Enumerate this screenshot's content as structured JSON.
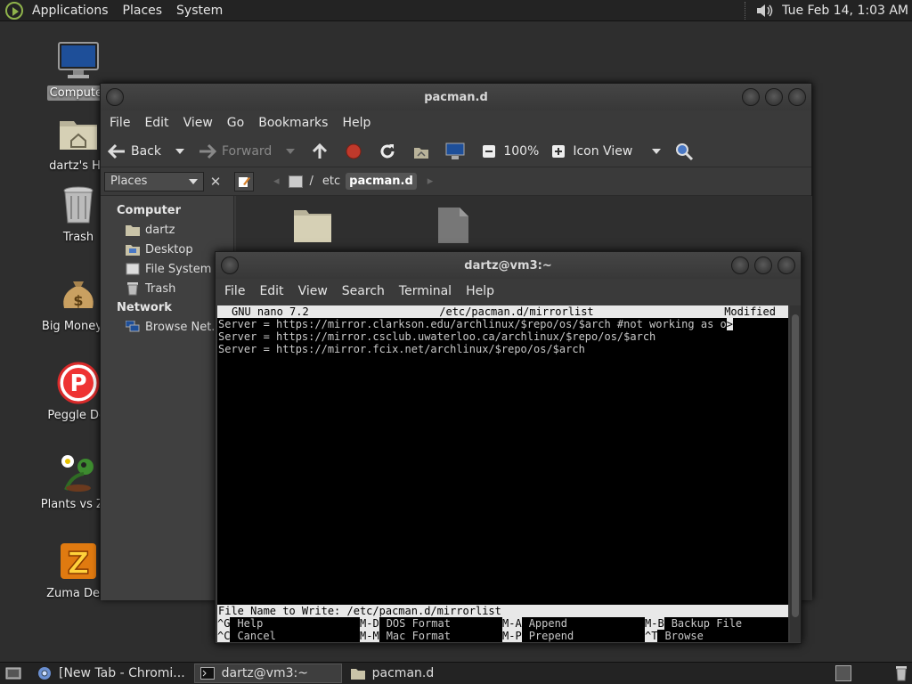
{
  "top_panel": {
    "menus": [
      "Applications",
      "Places",
      "System"
    ],
    "clock": "Tue Feb 14,  1:03 AM"
  },
  "desktop": {
    "icons": [
      {
        "label": "Computer",
        "icon": "monitor-icon"
      },
      {
        "label": "dartz's Ho",
        "icon": "home-folder-icon"
      },
      {
        "label": "Trash",
        "icon": "trash-icon"
      },
      {
        "label": "Big Money D",
        "icon": "money-bag-icon"
      },
      {
        "label": "Peggle Del",
        "icon": "peggle-icon"
      },
      {
        "label": "Plants vs Zor",
        "icon": "plants-icon"
      },
      {
        "label": "Zuma Delu",
        "icon": "zuma-icon"
      }
    ]
  },
  "file_manager": {
    "title": "pacman.d",
    "menu": [
      "File",
      "Edit",
      "View",
      "Go",
      "Bookmarks",
      "Help"
    ],
    "toolbar": {
      "back": "Back",
      "forward": "Forward",
      "zoom": "100%",
      "view_mode": "Icon View"
    },
    "places_label": "Places",
    "breadcrumbs": [
      "/",
      "etc",
      "pacman.d"
    ],
    "sidebar": {
      "computer_heading": "Computer",
      "computer_items": [
        "dartz",
        "Desktop",
        "File System",
        "Trash"
      ],
      "network_heading": "Network",
      "network_items": [
        "Browse Net..."
      ]
    }
  },
  "terminal": {
    "title": "dartz@vm3:~",
    "menu": [
      "File",
      "Edit",
      "View",
      "Search",
      "Terminal",
      "Help"
    ],
    "nano": {
      "version": "GNU nano 7.2",
      "filename": "/etc/pacman.d/mirrorlist",
      "status": "Modified",
      "lines": [
        "Server = https://mirror.clarkson.edu/archlinux/$repo/os/$arch #not working as o",
        "Server = https://mirror.csclub.uwaterloo.ca/archlinux/$repo/os/$arch",
        "Server = https://mirror.fcix.net/archlinux/$repo/os/$arch"
      ],
      "overflow_marker": ">",
      "prompt": "File Name to Write: /etc/pacman.d/mirrorlist",
      "help_row1": [
        {
          "key": "^G",
          "desc": "Help"
        },
        {
          "key": "M-D",
          "desc": "DOS Format"
        },
        {
          "key": "M-A",
          "desc": "Append"
        },
        {
          "key": "M-B",
          "desc": "Backup File"
        }
      ],
      "help_row2": [
        {
          "key": "^C",
          "desc": "Cancel"
        },
        {
          "key": "M-M",
          "desc": "Mac Format"
        },
        {
          "key": "M-P",
          "desc": "Prepend"
        },
        {
          "key": "^T",
          "desc": "Browse"
        }
      ]
    }
  },
  "taskbar": {
    "tasks": [
      {
        "label": "[New Tab - Chromi...",
        "icon": "chromium-icon"
      },
      {
        "label": "dartz@vm3:~",
        "icon": "terminal-icon"
      },
      {
        "label": "pacman.d",
        "icon": "folder-icon"
      }
    ]
  }
}
